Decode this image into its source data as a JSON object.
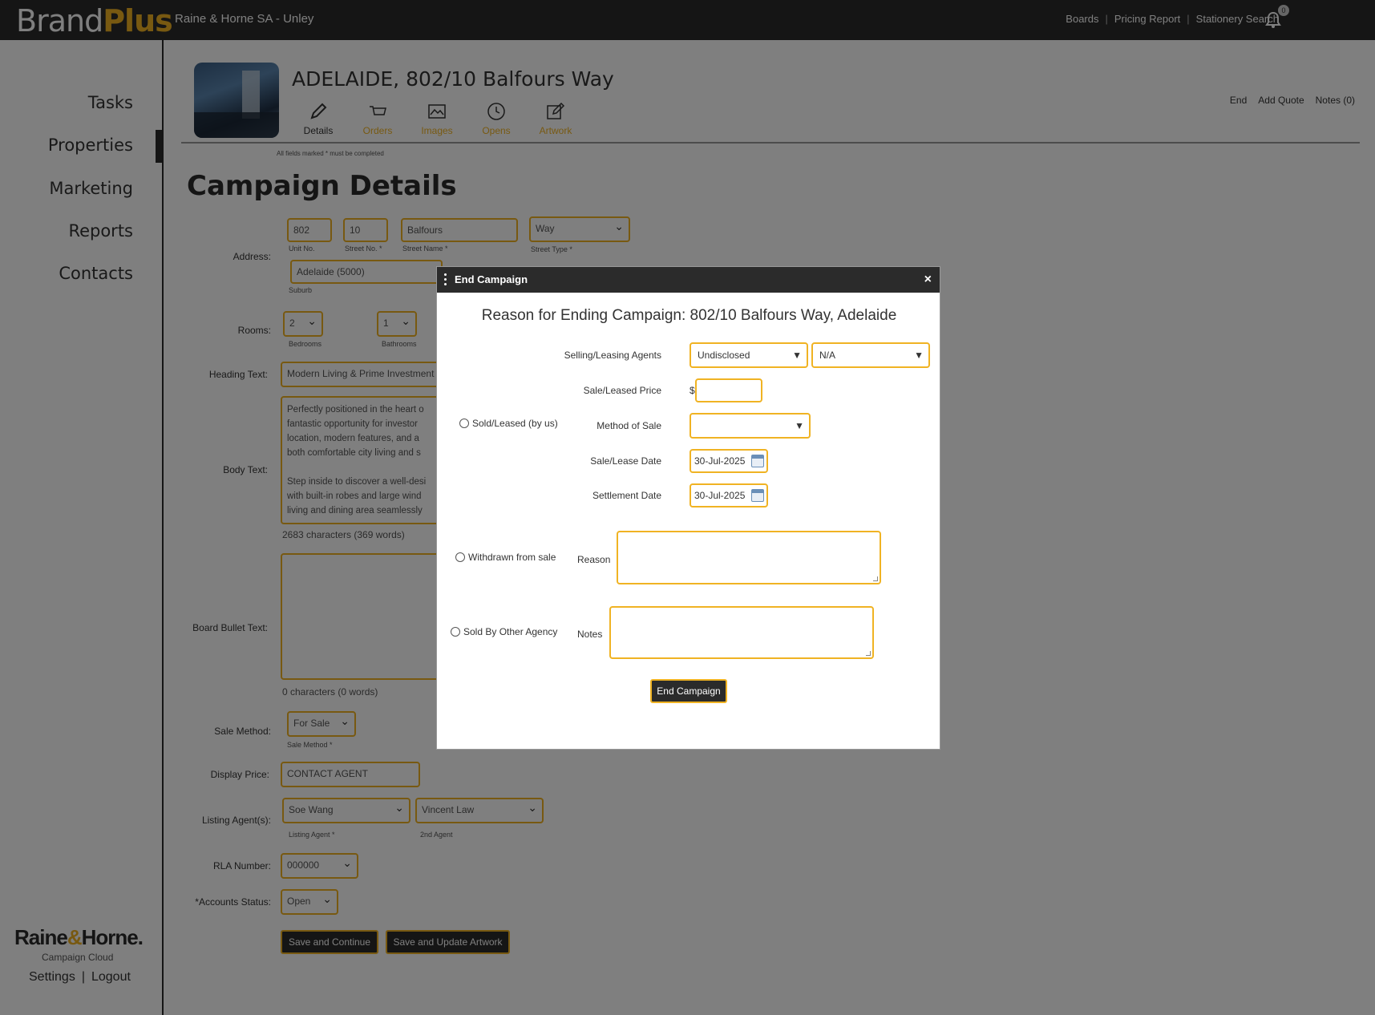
{
  "brand": {
    "part1": "Brand",
    "part2": "Plus"
  },
  "office": "Raine & Horne SA - Unley",
  "top_links": [
    "Boards",
    "Pricing Report",
    "Stationery Search"
  ],
  "notification_count": "0",
  "sidebar": {
    "items": [
      "Tasks",
      "Properties",
      "Marketing",
      "Reports",
      "Contacts"
    ],
    "active": "Properties",
    "logo": {
      "part1": "Raine",
      "amp": "&",
      "part2": "Horne."
    },
    "logo_sub": "Campaign Cloud",
    "settings": "Settings",
    "sep": "|",
    "logout": "Logout"
  },
  "property": {
    "title": "ADELAIDE, 802/10 Balfours Way",
    "tabs": [
      "Details",
      "Orders",
      "Images",
      "Opens",
      "Artwork"
    ],
    "right_links": [
      "End",
      "Add Quote",
      "Notes (0)"
    ]
  },
  "form": {
    "required_note": "All fields marked * must be completed",
    "heading": "Campaign Details",
    "address_label": "Address:",
    "unit_no": "802",
    "unit_no_label": "Unit No.",
    "street_no": "10",
    "street_no_label": "Street No. *",
    "street_name": "Balfours",
    "street_name_label": "Street Name *",
    "street_type": "Way",
    "street_type_label": "Street Type *",
    "suburb": "Adelaide (5000)",
    "suburb_label": "Suburb",
    "rooms_label": "Rooms:",
    "bedrooms": "2",
    "bedrooms_label": "Bedrooms",
    "bathrooms": "1",
    "bathrooms_label": "Bathrooms",
    "heading_text_label": "Heading Text:",
    "heading_text": "Modern Living & Prime Investment",
    "body_text_label": "Body Text:",
    "body_text_lines": [
      "Perfectly positioned in the heart o",
      "fantastic opportunity for investor",
      "location, modern features, and a",
      "both comfortable city living and s",
      "",
      "Step inside to discover a well-desi",
      "with built-in robes and large wind",
      "living and dining area seamlessly"
    ],
    "body_count": "2683 characters (369 words)",
    "board_bullet_label": "Board Bullet Text:",
    "board_count": "0 characters (0 words)",
    "sale_method_label": "Sale Method:",
    "sale_method": "For Sale",
    "sale_method_sub": "Sale Method *",
    "display_price_label": "Display Price:",
    "display_price": "CONTACT AGENT",
    "listing_agents_label": "Listing Agent(s):",
    "listing_agent": "Soe Wang",
    "listing_agent_sub": "Listing Agent *",
    "second_agent": "Vincent Law",
    "second_agent_sub": "2nd Agent",
    "rla_label": "RLA Number:",
    "rla": "000000",
    "accounts_label": "*Accounts Status:",
    "accounts": "Open",
    "save_continue": "Save and Continue",
    "save_update": "Save and Update Artwork"
  },
  "modal": {
    "header": "End Campaign",
    "close": "×",
    "title": "Reason for Ending Campaign: 802/10 Balfours Way, Adelaide",
    "agents_label": "Selling/Leasing Agents",
    "agent1": "Undisclosed",
    "agent2": "N/A",
    "price_label": "Sale/Leased Price",
    "currency": "$",
    "price_value": "",
    "sold_option": "Sold/Leased (by us)",
    "method_label": "Method of Sale",
    "method_value": "",
    "sale_date_label": "Sale/Lease Date",
    "sale_date": "30-Jul-2025",
    "settlement_label": "Settlement Date",
    "settlement_date": "30-Jul-2025",
    "withdrawn_option": "Withdrawn from sale",
    "reason_label": "Reason",
    "other_agency_option": "Sold By Other Agency",
    "notes_label": "Notes",
    "submit": "End Campaign"
  }
}
